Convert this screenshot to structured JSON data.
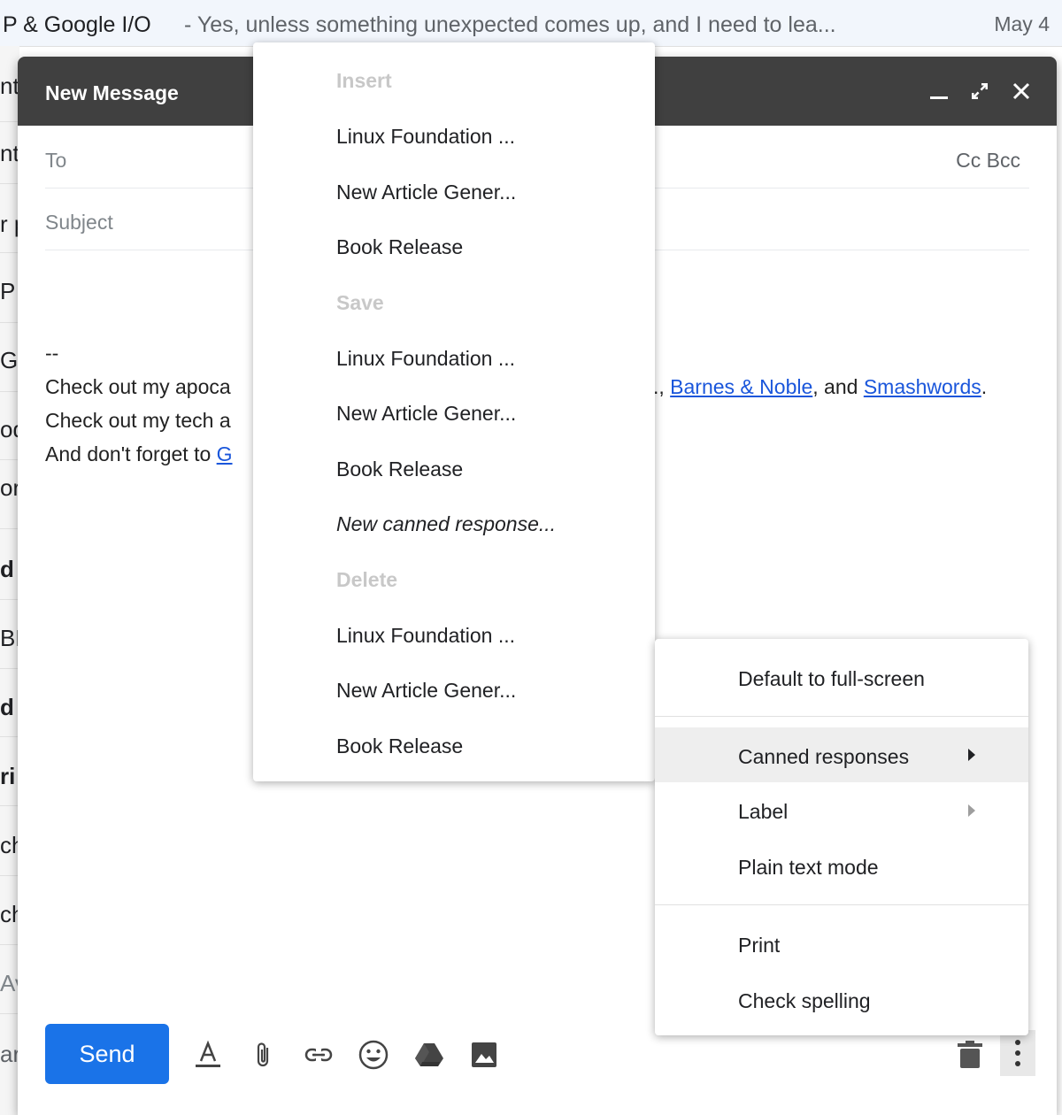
{
  "inbox_row": {
    "subject": "P & Google I/O",
    "snippet": "- Yes, unless something unexpected comes up, and I need to lea...",
    "date": "May 4"
  },
  "left_strip_fragments": [
    "nt",
    "nt",
    "r p",
    "P",
    "G",
    "od",
    "or",
    "d",
    "BE",
    "d",
    "ri",
    "ch",
    "ch",
    "Av",
    "ar"
  ],
  "compose": {
    "title": "New Message",
    "to_label": "To",
    "cc_bcc": "Cc  Bcc",
    "subject_label": "Subject",
    "signature": {
      "dashes": "--",
      "line1_start": "Check out my apoca",
      "line1_tail_sep": ".,",
      "line1_link1": "Barnes & Noble",
      "line1_mid": ", and",
      "line1_link2": "Smashwords",
      "line1_end": ".",
      "line2_start": "Check out my tech a",
      "line3_start": "And don't forget to",
      "line3_link": "G"
    },
    "send_label": "Send",
    "header_icons": [
      "minimize-icon",
      "fullscreen-icon",
      "close-icon"
    ],
    "toolbar_icons": [
      "format-text-icon",
      "attach-icon",
      "link-icon",
      "emoji-icon",
      "drive-icon",
      "photo-icon",
      "trash-icon",
      "more-options-icon"
    ]
  },
  "canned_menu": {
    "insert_header": "Insert",
    "insert_items": [
      "Linux Foundation ...",
      "New Article Gener...",
      "Book Release"
    ],
    "save_header": "Save",
    "save_items": [
      "Linux Foundation ...",
      "New Article Gener...",
      "Book Release"
    ],
    "new_response": "New canned response...",
    "delete_header": "Delete",
    "delete_items": [
      "Linux Foundation ...",
      "New Article Gener...",
      "Book Release"
    ]
  },
  "more_menu": {
    "items": [
      "Default to full-screen",
      "Canned responses",
      "Label",
      "Plain text mode",
      "Print",
      "Check spelling"
    ]
  },
  "colors": {
    "header_bg": "#404040",
    "send_blue": "#1a73e8",
    "link_blue": "#1a56db"
  }
}
